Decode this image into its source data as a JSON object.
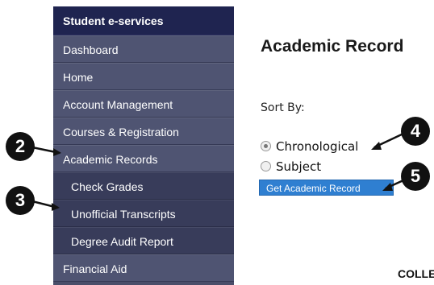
{
  "sidebar": {
    "header": "Student e-services",
    "items": [
      {
        "label": "Dashboard",
        "sub": false
      },
      {
        "label": "Home",
        "sub": false
      },
      {
        "label": "Account Management",
        "sub": false
      },
      {
        "label": "Courses & Registration",
        "sub": false
      },
      {
        "label": "Academic Records",
        "sub": false
      },
      {
        "label": "Check Grades",
        "sub": true
      },
      {
        "label": "Unofficial Transcripts",
        "sub": true
      },
      {
        "label": "Degree Audit Report",
        "sub": true
      },
      {
        "label": "Financial Aid",
        "sub": false
      }
    ]
  },
  "main": {
    "title": "Academic Record",
    "sort_label": "Sort By:",
    "options": [
      {
        "label": "Chronological",
        "checked": true
      },
      {
        "label": "Subject",
        "checked": false
      }
    ],
    "button_label": "Get Academic Record"
  },
  "callouts": [
    "2",
    "3",
    "4",
    "5"
  ],
  "logo_text": "COLLEG",
  "colors": {
    "sidebar_header": "#1f2450",
    "sidebar_item": "#4f5472",
    "sidebar_subitem": "#383c5a",
    "button": "#2f7fd1",
    "callout": "#111111"
  }
}
